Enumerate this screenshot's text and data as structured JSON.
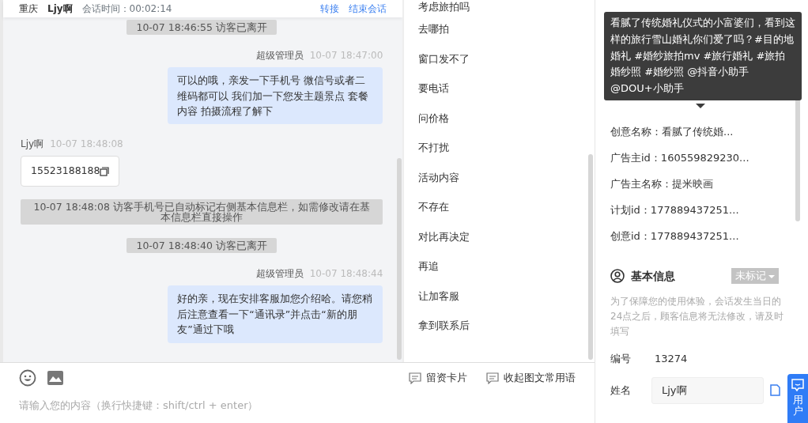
{
  "header": {
    "location": "重庆",
    "visitor": "Ljy啊",
    "duration": "会话时间：00:02:14",
    "actions": [
      "转接",
      "结束会话"
    ]
  },
  "messages": [
    {
      "kind": "system",
      "text": "10-07 18:46:55 访客已离开"
    },
    {
      "kind": "agent",
      "sender": "超级管理员",
      "time": "10-07 18:47:00",
      "text": "可以的哦，亲发一下手机号 微信号或者二维码都可以 我们加一下您发主题景点 套餐内容 拍摄流程了解下"
    },
    {
      "kind": "visitor",
      "sender": "Ljy啊",
      "time": "10-07 18:48:08",
      "text": "15523188188"
    },
    {
      "kind": "system",
      "text": "10-07 18:48:08 访客手机号已自动标记右侧基本信息栏，如需修改请在基本信息栏直接操作"
    },
    {
      "kind": "system",
      "text": "10-07 18:48:40 访客已离开"
    },
    {
      "kind": "agent",
      "sender": "超级管理员",
      "time": "10-07 18:48:44",
      "text": "好的亲，现在安排客服加您介绍哈。请您稍后注意查看一下“通讯录”并点击“新的朋友”通过下哦"
    }
  ],
  "quick_replies": [
    "考虑旅拍吗",
    "去哪拍",
    "窗口发不了",
    "要电话",
    "问价格",
    "不打扰",
    "活动内容",
    "不存在",
    "对比再决定",
    "再追",
    "让加客服",
    "拿到联系后"
  ],
  "composer": {
    "placeholder": "请输入您的内容（换行快捷键：shift/ctrl + enter）",
    "tools": [
      "留资卡片",
      "收起图文常用语"
    ]
  },
  "tooltip": "看腻了传统婚礼仪式的小富婆们，看到这样的旅行雪山婚礼你们爱了吗？#目的地婚礼 #婚纱旅拍mv #旅行婚礼 #旅拍婚纱照 #婚纱照 @抖音小助手 @DOU+小助手",
  "source_info": [
    "创意名称：看腻了传统婚...",
    "广告主id：160559829230...",
    "广告主名称：提米映画",
    "计划id：177889437251...",
    "创意id：177889437251..."
  ],
  "basic_info": {
    "title": "基本信息",
    "tag": "未标记",
    "note": "为了保障您的使用体验，会话发生当日的24点之后，顾客信息将无法修改，请及时填写",
    "id_label": "编号",
    "id_value": "13274",
    "name_label": "姓名",
    "name_value": "Ljy啊"
  },
  "float_tab": "用户"
}
